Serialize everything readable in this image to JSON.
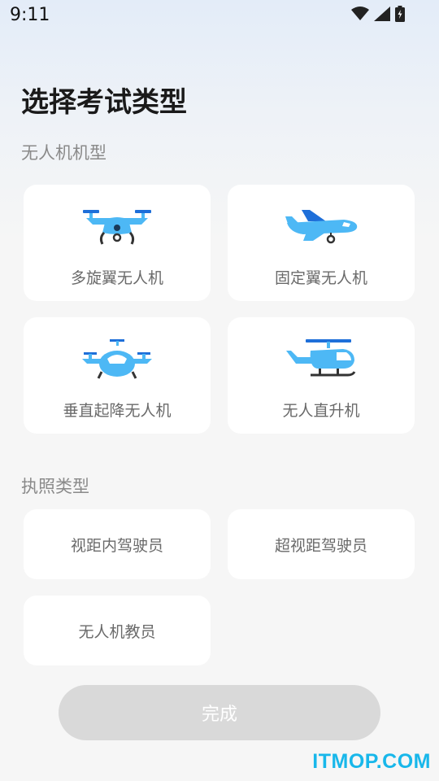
{
  "status_bar": {
    "time": "9:11"
  },
  "page": {
    "title": "选择考试类型"
  },
  "sections": {
    "aircraft_type_label": "无人机机型",
    "license_type_label": "执照类型"
  },
  "aircraft_types": [
    {
      "label": "多旋翼无人机",
      "icon": "multirotor-drone-icon"
    },
    {
      "label": "固定翼无人机",
      "icon": "fixed-wing-plane-icon"
    },
    {
      "label": "垂直起降无人机",
      "icon": "vtol-drone-icon"
    },
    {
      "label": "无人直升机",
      "icon": "helicopter-icon"
    }
  ],
  "license_types": [
    {
      "label": "视距内驾驶员"
    },
    {
      "label": "超视距驾驶员"
    },
    {
      "label": "无人机教员"
    }
  ],
  "footer": {
    "done_label": "完成"
  },
  "watermark": "ITMOP.COM",
  "colors": {
    "accent": "#4db8f5",
    "accent_dark": "#1e6fd9",
    "button_disabled": "#d9d9d9",
    "watermark": "#18b7ea"
  }
}
